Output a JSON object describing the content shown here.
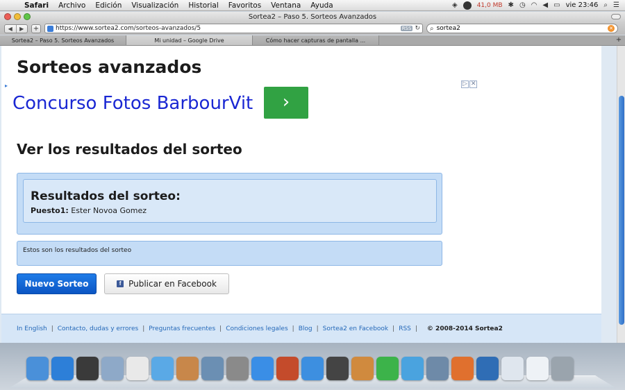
{
  "menubar": {
    "app_name": "Safari",
    "items": [
      "Archivo",
      "Edición",
      "Visualización",
      "Historial",
      "Favoritos",
      "Ventana",
      "Ayuda"
    ],
    "memory": "41,0 MB",
    "clock": "vie 23:46"
  },
  "window": {
    "title": "Sortea2 – Paso 5. Sorteos Avanzados"
  },
  "toolbar": {
    "url": "https://www.sortea2.com/sorteos-avanzados/5",
    "rss_label": "RSS",
    "search_value": "sortea2"
  },
  "tabs": [
    {
      "label": "Sortea2 – Paso 5. Sorteos Avanzados"
    },
    {
      "label": "Mi unidad – Google Drive"
    },
    {
      "label": "Cómo hacer capturas de pantalla ..."
    }
  ],
  "page": {
    "heading": "Sorteos avanzados",
    "ad": {
      "marker": "▸",
      "text": "Concurso Fotos BarbourVit",
      "button": "›",
      "choices": [
        "▷",
        "✕"
      ]
    },
    "section_title": "Ver los resultados del sorteo",
    "results": {
      "title": "Resultados del sorteo:",
      "place_label": "Puesto1:",
      "place_value": "Ester Novoa Gomez"
    },
    "info_text": "Estos son los resultados del sorteo",
    "new_button": "Nuevo Sorteo",
    "facebook_button": "Publicar en Facebook",
    "footer": {
      "links": [
        "In English",
        "Contacto, dudas y errores",
        "Preguntas frecuentes",
        "Condiciones legales",
        "Blog",
        "Sortea2 en Facebook",
        "RSS"
      ],
      "copyright": "© 2008-2014 Sortea2"
    }
  },
  "dock": {
    "icons": [
      {
        "name": "finder-icon",
        "color": "#4a90d9"
      },
      {
        "name": "app-store-icon",
        "color": "#2d7fd8"
      },
      {
        "name": "dashboard-icon",
        "color": "#3a3a3a"
      },
      {
        "name": "mail-icon",
        "color": "#8ea9c8"
      },
      {
        "name": "calendar-icon",
        "color": "#e9e9e9"
      },
      {
        "name": "facetime-icon",
        "color": "#5aa9e6"
      },
      {
        "name": "address-book-icon",
        "color": "#c8874a"
      },
      {
        "name": "iphoto-icon",
        "color": "#6b8fb3"
      },
      {
        "name": "system-preferences-icon",
        "color": "#8a8a8a"
      },
      {
        "name": "itunes-icon",
        "color": "#3a8ee6"
      },
      {
        "name": "photo-booth-icon",
        "color": "#c44b2b"
      },
      {
        "name": "safari-icon",
        "color": "#3d8fe0"
      },
      {
        "name": "starcraft-icon",
        "color": "#444444"
      },
      {
        "name": "garageband-icon",
        "color": "#d08a3e"
      },
      {
        "name": "spotify-icon",
        "color": "#3cb34a"
      },
      {
        "name": "messenger-icon",
        "color": "#4aa3df"
      },
      {
        "name": "preview-icon",
        "color": "#6e8aa8"
      },
      {
        "name": "powerpoint-icon",
        "color": "#e0702e"
      },
      {
        "name": "quicktime-icon",
        "color": "#2f6db5"
      },
      {
        "name": "robot-icon",
        "color": "#dfe6ee"
      },
      {
        "name": "document-icon",
        "color": "#eef2f6"
      },
      {
        "name": "trash-icon",
        "color": "#9aa4ad"
      }
    ]
  }
}
